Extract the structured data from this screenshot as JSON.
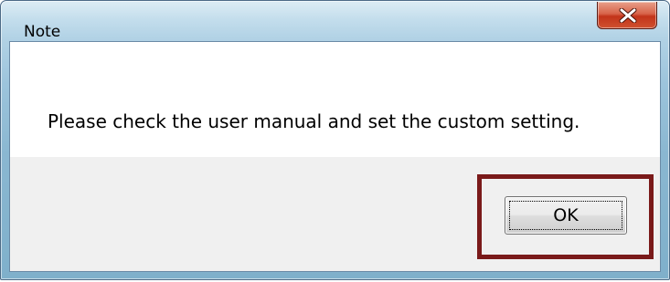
{
  "window": {
    "title": "Note"
  },
  "close_button": {
    "icon": "close-icon"
  },
  "dialog": {
    "message": "Please check the user manual and set the custom setting."
  },
  "buttons": {
    "ok_label": "OK"
  },
  "colors": {
    "highlight_border": "#7a1a1a",
    "close_button_red": "#c2341a",
    "footer_bg": "#f0f0f0"
  }
}
